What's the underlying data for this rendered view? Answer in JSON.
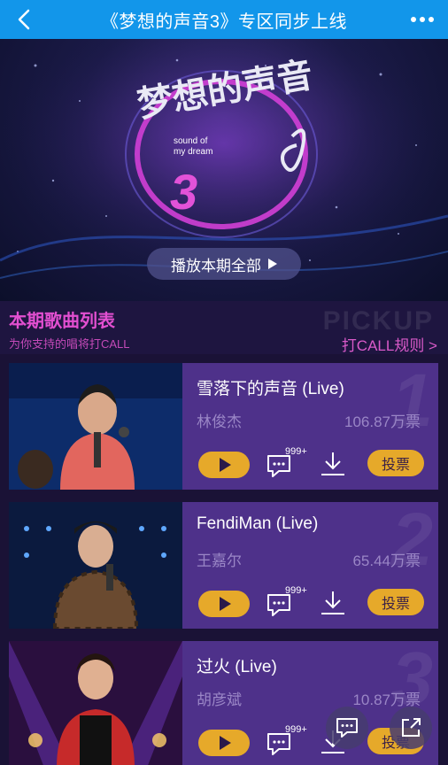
{
  "topbar": {
    "title": "《梦想的声音3》专区同步上线",
    "back_icon": "back-arrow-icon",
    "more_icon": "more-dots-icon"
  },
  "banner": {
    "logo_text": "梦想的声音",
    "logo_number": "3",
    "logo_en_line1": "sound of",
    "logo_en_line2": "my dream",
    "play_all_label": "播放本期全部"
  },
  "section": {
    "heading": "本期歌曲列表",
    "subtitle": "为你支持的唱将打CALL",
    "watermark": "PICKUP",
    "rules_link": "打CALL规则 >"
  },
  "songs": [
    {
      "rank": "1",
      "title": "雪落下的声音 (Live)",
      "singer": "林俊杰",
      "votes": "106.87万票",
      "comments": "999+",
      "vote_label": "投票"
    },
    {
      "rank": "2",
      "title": "FendiMan (Live)",
      "singer": "王嘉尔",
      "votes": "65.44万票",
      "comments": "999+",
      "vote_label": "投票"
    },
    {
      "rank": "3",
      "title": "过火 (Live)",
      "singer": "胡彦斌",
      "votes": "10.87万票",
      "comments": "999+",
      "vote_label": "投票"
    }
  ],
  "colors": {
    "topbar": "#1296ea",
    "accent_pink": "#e24fd0",
    "card_purple": "#4e318a",
    "button_gold": "#e6a92a"
  }
}
